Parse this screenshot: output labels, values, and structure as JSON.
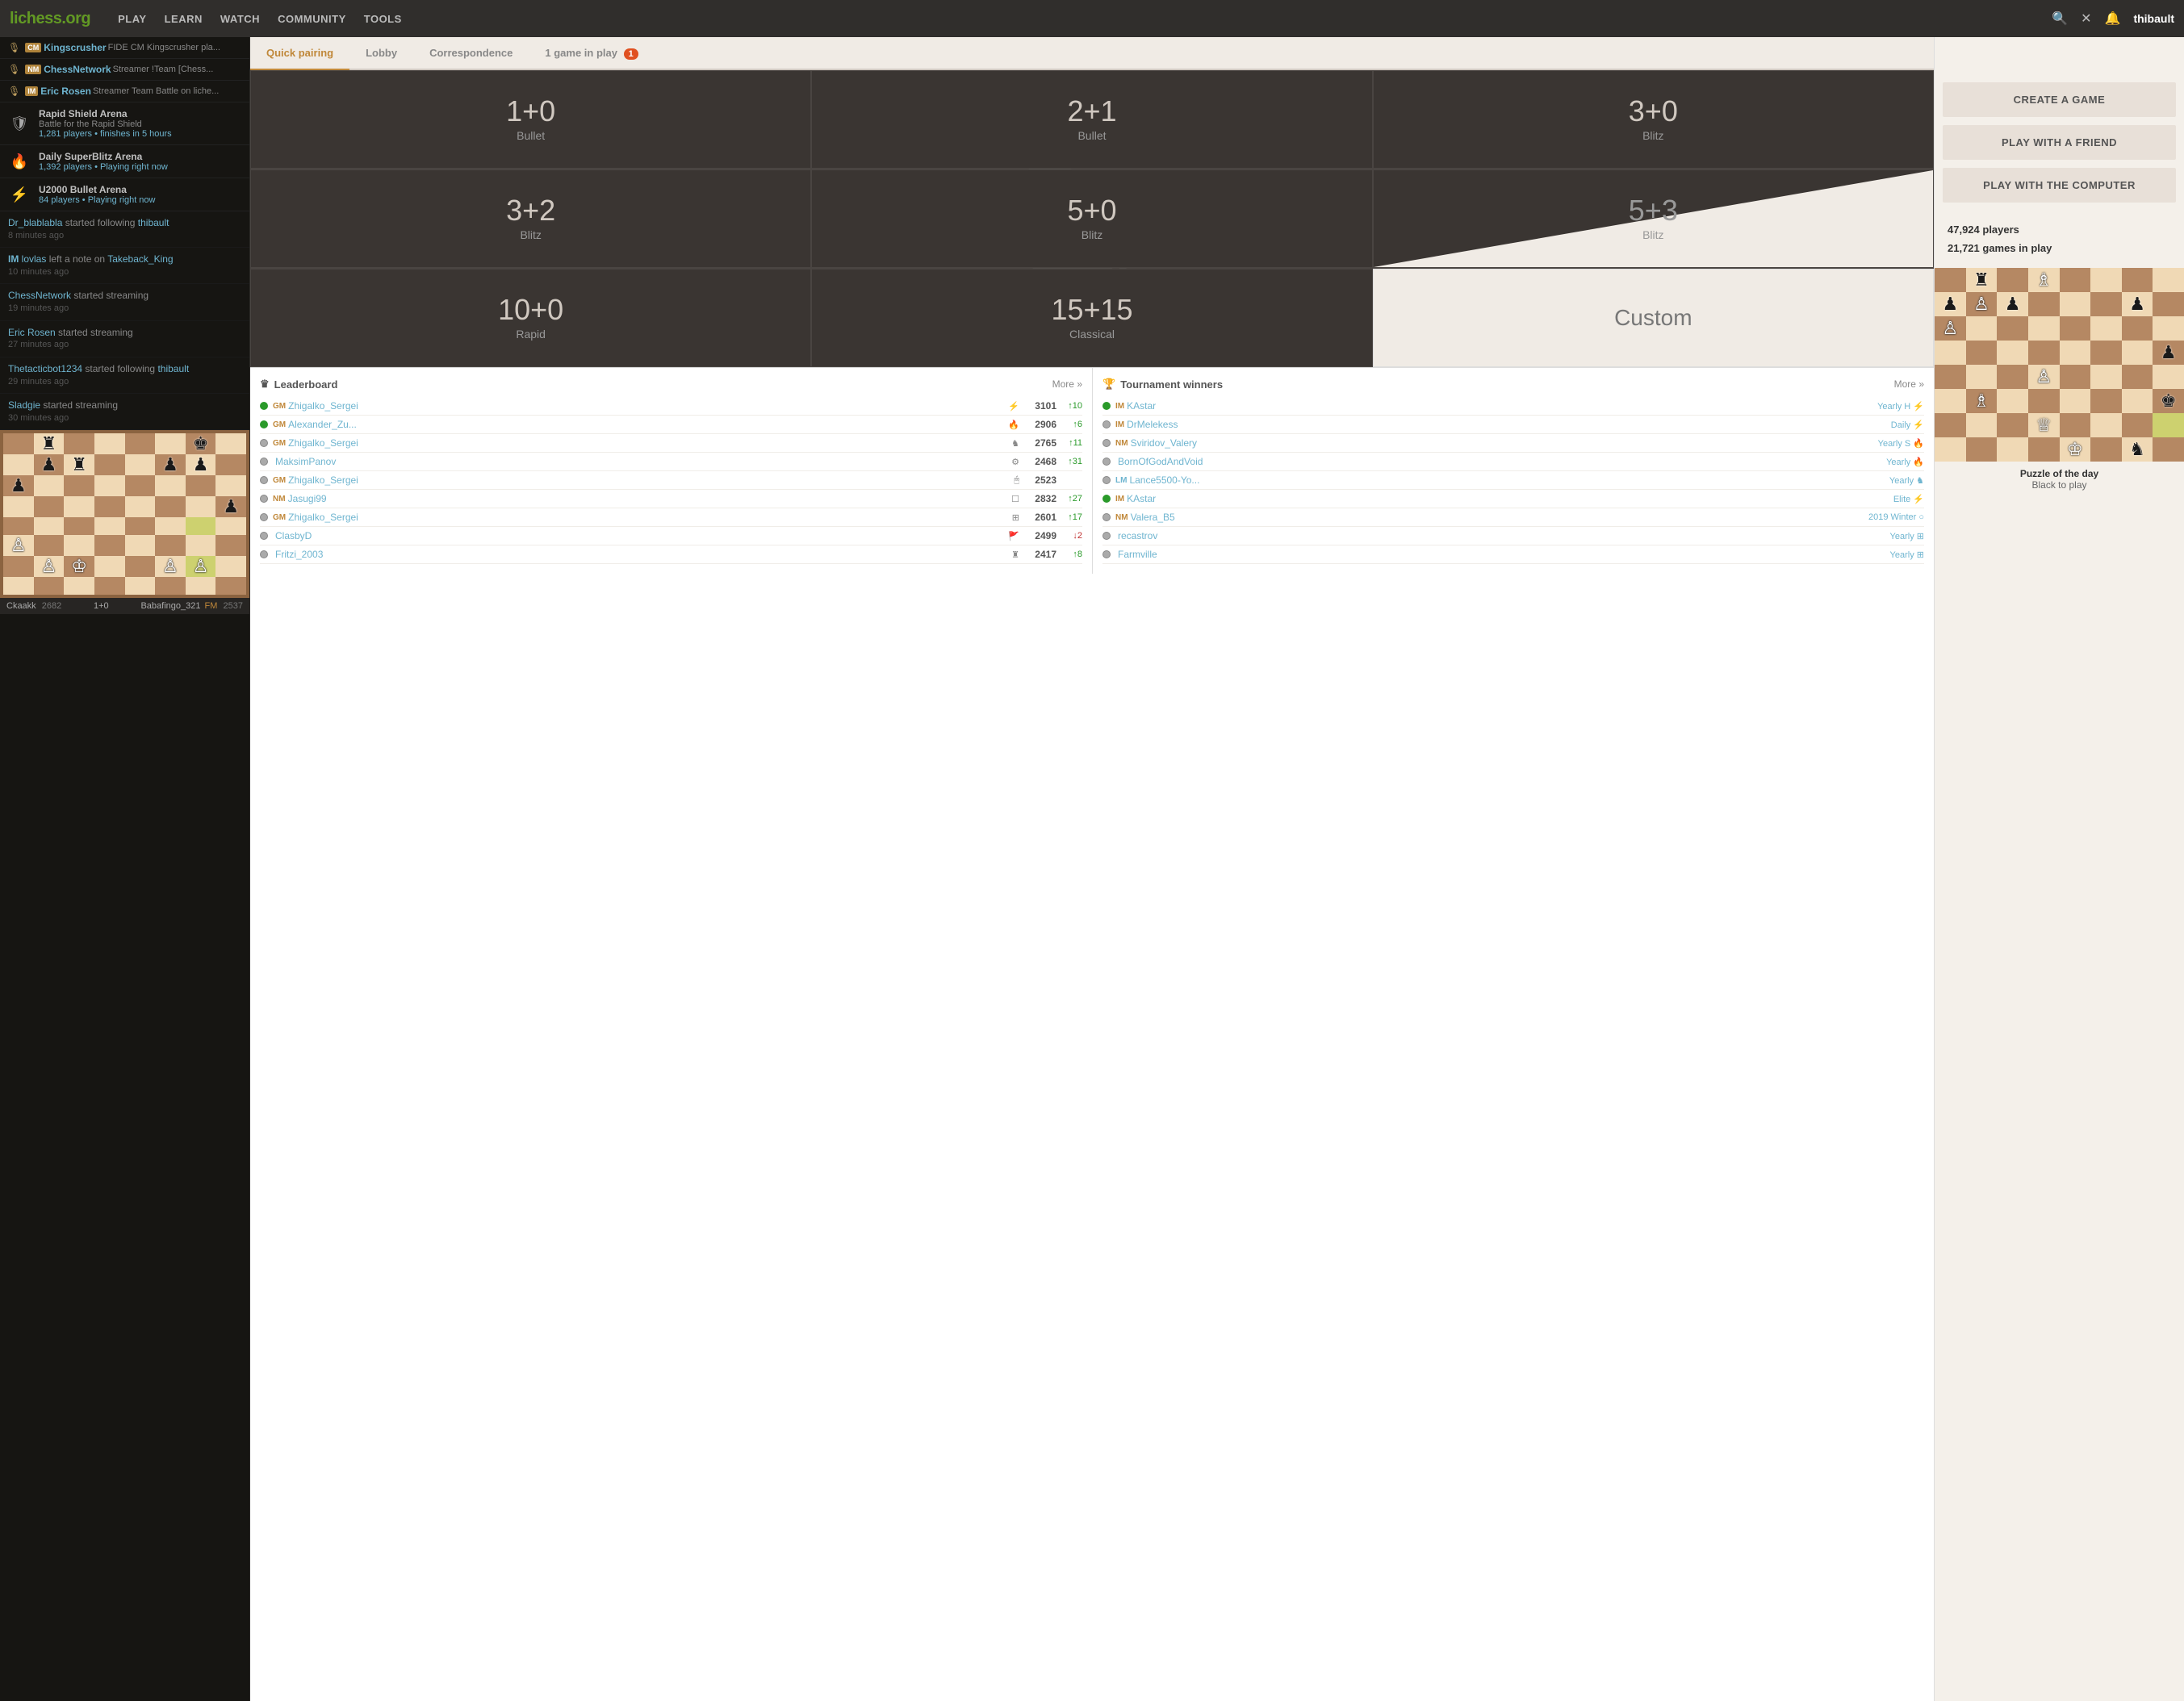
{
  "header": {
    "logo": "lichess.org",
    "nav": [
      "PLAY",
      "LEARN",
      "WATCH",
      "COMMUNITY",
      "TOOLS"
    ],
    "username": "thibault",
    "game_in_play": "1 game in play",
    "game_badge": "1"
  },
  "tabs": {
    "items": [
      {
        "label": "Quick pairing",
        "active": true
      },
      {
        "label": "Lobby",
        "active": false
      },
      {
        "label": "Correspondence",
        "active": false
      },
      {
        "label": "1 game in play",
        "active": false,
        "badge": "1"
      }
    ]
  },
  "quick_pairing": {
    "cells": [
      {
        "time": "1+0",
        "type": "Bullet",
        "theme": "dark"
      },
      {
        "time": "2+1",
        "type": "Bullet",
        "theme": "dark"
      },
      {
        "time": "3+0",
        "type": "Blitz",
        "theme": "dark"
      },
      {
        "time": "3+2",
        "type": "Blitz",
        "theme": "dark"
      },
      {
        "time": "5+0",
        "type": "Blitz",
        "theme": "dark"
      },
      {
        "time": "5+3",
        "type": "Blitz",
        "theme": "dark"
      },
      {
        "time": "10+0",
        "type": "Rapid",
        "theme": "dark"
      },
      {
        "time": "15+15",
        "type": "Classical",
        "theme": "dark"
      },
      {
        "time": "Custom",
        "type": "",
        "theme": "light"
      }
    ]
  },
  "right_actions": {
    "create": "CREATE A GAME",
    "friend": "PLAY WITH A FRIEND",
    "computer": "PLAY WITH THE COMPUTER",
    "players": "47,924 players",
    "games": "21,721 games in play"
  },
  "streamers": [
    {
      "title": "CM",
      "name": "Kingscrusher",
      "desc": "FIDE CM Kingscrusher pla..."
    },
    {
      "title": "NM",
      "name": "ChessNetwork",
      "desc": "Streamer !Team [Chess..."
    },
    {
      "title": "IM",
      "name": "Eric Rosen",
      "desc": "Streamer Team Battle on liche..."
    }
  ],
  "tournaments": [
    {
      "icon": "shield",
      "name": "Rapid Shield Arena",
      "desc1": "Battle for the Rapid Shield",
      "desc2": "1,281 players • finishes in 5 hours"
    },
    {
      "icon": "fire",
      "name": "Daily SuperBlitz Arena",
      "desc1": "",
      "desc2": "1,392 players • Playing right now"
    },
    {
      "icon": "bolt",
      "name": "U2000 Bullet Arena",
      "desc1": "",
      "desc2": "84 players • Playing right now"
    }
  ],
  "activity": [
    {
      "text": "Dr_blablabla started following thibault",
      "time": "8 minutes ago"
    },
    {
      "text": "IM lovlas left a note on Takeback_King",
      "time": "10 minutes ago"
    },
    {
      "text": "ChessNetwork started streaming",
      "time": "19 minutes ago"
    },
    {
      "text": "Eric Rosen started streaming",
      "time": "27 minutes ago"
    },
    {
      "text": "Thetacticbot1234 started following thibault",
      "time": "29 minutes ago"
    },
    {
      "text": "Sladgie started streaming",
      "time": "30 minutes ago"
    }
  ],
  "mini_board_info": {
    "white": "Ckaakk",
    "white_rating": "2682",
    "black": "Babafingo_321",
    "black_rating": "2537",
    "black_title": "FM",
    "time_control": "1+0"
  },
  "leaderboard": {
    "title": "Leaderboard",
    "more": "More »",
    "rows": [
      {
        "online": true,
        "title": "GM",
        "name": "Zhigalko_Sergei",
        "icon": "⚡",
        "rating": "3101",
        "trend": "↑10",
        "trend_dir": "up"
      },
      {
        "online": true,
        "title": "GM",
        "name": "Alexander_Zu...",
        "icon": "🔥",
        "rating": "2906",
        "trend": "↑6",
        "trend_dir": "up"
      },
      {
        "online": false,
        "title": "GM",
        "name": "Zhigalko_Sergei",
        "icon": "♞",
        "rating": "2765",
        "trend": "↑11",
        "trend_dir": "up"
      },
      {
        "online": false,
        "title": "",
        "name": "MaksimPanov",
        "icon": "⚙",
        "rating": "2468",
        "trend": "↑31",
        "trend_dir": "up"
      },
      {
        "online": false,
        "title": "GM",
        "name": "Zhigalko_Sergei",
        "icon": "🖱",
        "rating": "2523",
        "trend": "",
        "trend_dir": ""
      },
      {
        "online": false,
        "title": "NM",
        "name": "Jasugi99",
        "icon": "□",
        "rating": "2832",
        "trend": "↑27",
        "trend_dir": "up"
      },
      {
        "online": false,
        "title": "GM",
        "name": "Zhigalko_Sergei",
        "icon": "⊞",
        "rating": "2601",
        "trend": "↑17",
        "trend_dir": "up"
      },
      {
        "online": false,
        "title": "",
        "name": "ClasbyD",
        "icon": "🚩",
        "rating": "2499",
        "trend": "↓2",
        "trend_dir": "down"
      },
      {
        "online": false,
        "title": "",
        "name": "Fritzi_2003",
        "icon": "♜",
        "rating": "2417",
        "trend": "↑8",
        "trend_dir": "up"
      }
    ]
  },
  "tournament_winners": {
    "title": "Tournament winners",
    "more": "More »",
    "rows": [
      {
        "online": true,
        "title": "IM",
        "name": "KAstar",
        "tournament": "Yearly H",
        "type_icon": "⚡",
        "color": "#6fb5d0"
      },
      {
        "online": false,
        "title": "IM",
        "name": "DrMelekess",
        "tournament": "Daily",
        "type_icon": "⚡",
        "color": "#6fb5d0"
      },
      {
        "online": false,
        "title": "NM",
        "name": "Sviridov_Valery",
        "tournament": "Yearly S",
        "type_icon": "🔥",
        "color": "#6fb5d0"
      },
      {
        "online": false,
        "title": "",
        "name": "BornOfGodAndVoid",
        "tournament": "Yearly",
        "type_icon": "🔥",
        "color": "#6fb5d0"
      },
      {
        "online": false,
        "title": "LM",
        "name": "Lance5500-Yo...",
        "tournament": "Yearly",
        "type_icon": "♞",
        "color": "#6fb5d0"
      },
      {
        "online": true,
        "title": "IM",
        "name": "KAstar",
        "tournament": "Elite",
        "type_icon": "⚡",
        "color": "#6fb5d0"
      },
      {
        "online": false,
        "title": "NM",
        "name": "Valera_B5",
        "tournament": "2019 Winter",
        "type_icon": "○",
        "color": "#6fb5d0"
      },
      {
        "online": false,
        "title": "",
        "name": "recastrov",
        "tournament": "Yearly",
        "type_icon": "⊞",
        "color": "#6fb5d0"
      },
      {
        "online": false,
        "title": "",
        "name": "Farmville",
        "tournament": "Yearly",
        "type_icon": "⊞",
        "color": "#6fb5d0"
      }
    ]
  },
  "puzzle": {
    "title": "Puzzle of the day",
    "subtitle": "Black to play"
  }
}
